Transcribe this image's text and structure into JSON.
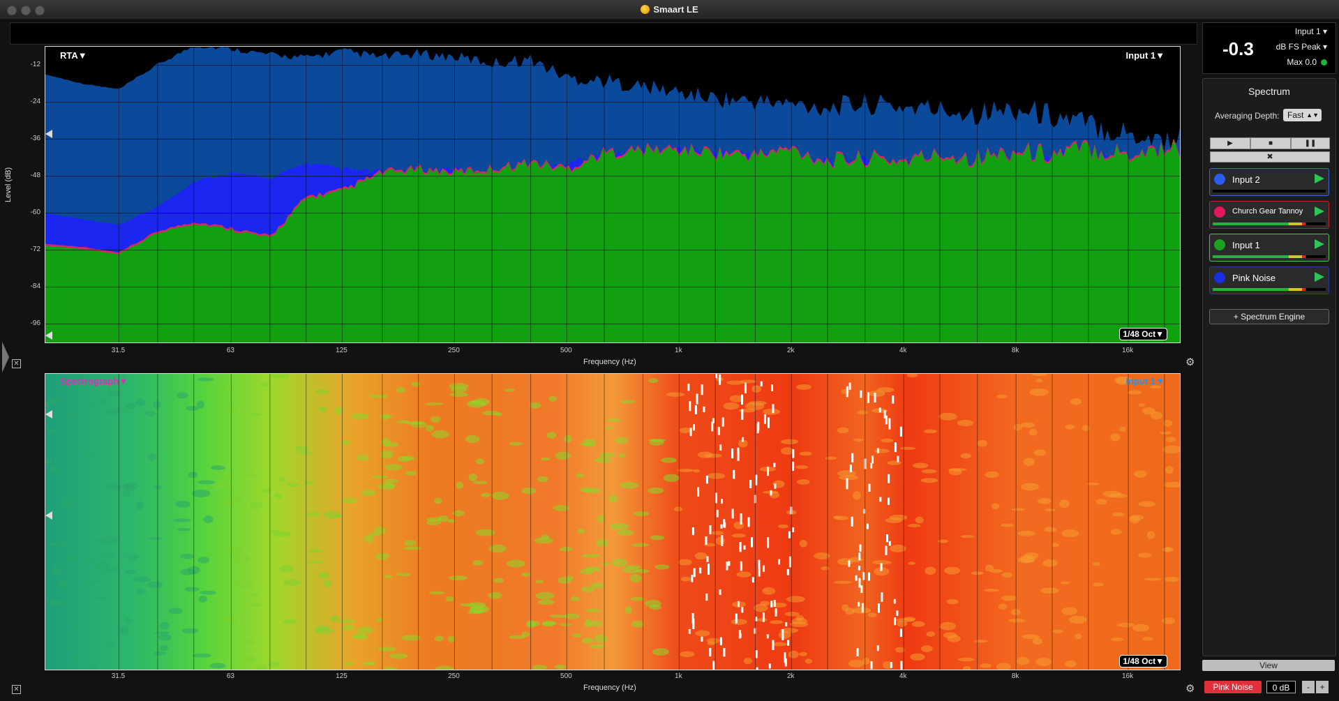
{
  "window": {
    "title": "Smaart LE"
  },
  "rta": {
    "label": "RTA▼",
    "input_label": "Input 1▼",
    "resolution": "1/48 Oct▼",
    "y_axis_title": "Level (dB)",
    "y_ticks": [
      "-12",
      "-24",
      "-36",
      "-48",
      "-60",
      "-72",
      "-84",
      "-96"
    ],
    "x_axis_title": "Frequency (Hz)",
    "x_ticks": [
      "31.5",
      "63",
      "125",
      "250",
      "500",
      "1k",
      "2k",
      "4k",
      "8k",
      "16k"
    ]
  },
  "spectrograph": {
    "label": "Spectrograph▼",
    "input_label": "Input 1▼",
    "resolution": "1/48 Oct▼",
    "x_axis_title": "Frequency (Hz)",
    "x_ticks": [
      "31.5",
      "63",
      "125",
      "250",
      "500",
      "1k",
      "2k",
      "4k",
      "8k",
      "16k"
    ]
  },
  "meter": {
    "value": "-0.3",
    "input": "Input 1",
    "unit": "dB FS Peak",
    "max": "Max 0.0"
  },
  "spectrum_panel": {
    "title": "Spectrum",
    "averaging_label": "Averaging Depth:",
    "averaging_value": "Fast",
    "engines": [
      {
        "name": "Input 2",
        "color": "#2d5cf0",
        "border": "#3a64d8",
        "level": 0.0
      },
      {
        "name": "Church Gear Tannoy",
        "color": "#e2185a",
        "border": "#c01c3c",
        "level": 0.8
      },
      {
        "name": "Input 1",
        "color": "#1ea020",
        "border": "#4cc24c",
        "level": 0.8
      },
      {
        "name": "Pink Noise",
        "color": "#1a2fe0",
        "border": "#2a3a9a",
        "level": 0.8
      }
    ],
    "add_engine": "+ Spectrum Engine"
  },
  "view_button": "View",
  "generator": {
    "label": "Pink Noise",
    "gain": "0 dB",
    "minus": "-",
    "plus": "+"
  },
  "chart_data": [
    {
      "type": "area",
      "x_scale": "log",
      "xlabel": "Frequency (Hz)",
      "ylabel": "Level (dB)",
      "xlim": [
        20,
        22000
      ],
      "ylim": [
        -102,
        -6
      ],
      "grid": true,
      "x": [
        20,
        25,
        31.5,
        40,
        50,
        63,
        80,
        100,
        125,
        160,
        200,
        250,
        315,
        400,
        500,
        630,
        800,
        1000,
        1250,
        1600,
        2000,
        2500,
        3150,
        4000,
        5000,
        6300,
        8000,
        10000,
        12500,
        16000,
        20000
      ],
      "series": [
        {
          "values": [
            -15,
            -18,
            -20,
            -12,
            -6,
            -7,
            -9,
            -10,
            -8,
            -10,
            -9,
            -10,
            -12,
            -11,
            -17,
            -18,
            -20,
            -22,
            -24,
            -25,
            -26,
            -27,
            -26,
            -27,
            -28,
            -29,
            -28,
            -30,
            -33,
            -36,
            -38
          ]
        },
        {
          "values": [
            -60,
            -62,
            -64,
            -58,
            -50,
            -47,
            -49,
            -44,
            -46,
            -47,
            -47,
            -46,
            -48,
            -47,
            -44,
            -42,
            -41,
            -40,
            -41,
            -42,
            -42,
            -45,
            -44,
            -47,
            -43,
            -47,
            -43,
            -43,
            -42,
            -45,
            -44
          ]
        },
        {
          "values": [
            -70,
            -71,
            -73,
            -66,
            -63,
            -65,
            -68,
            -55,
            -53,
            -47,
            -46,
            -47,
            -46,
            -44,
            -46,
            -41,
            -40,
            -40,
            -41,
            -42,
            -40,
            -44,
            -43,
            -44,
            -42,
            -43,
            -41,
            -42,
            -40,
            -42,
            -40
          ]
        }
      ]
    },
    {
      "type": "heatmap",
      "x_scale": "log",
      "xlabel": "Frequency (Hz)",
      "xlim": [
        20,
        22000
      ],
      "x": [
        20,
        31.5,
        63,
        125,
        250,
        500,
        1000,
        2000,
        4000,
        8000,
        16000,
        20000
      ]
    }
  ]
}
